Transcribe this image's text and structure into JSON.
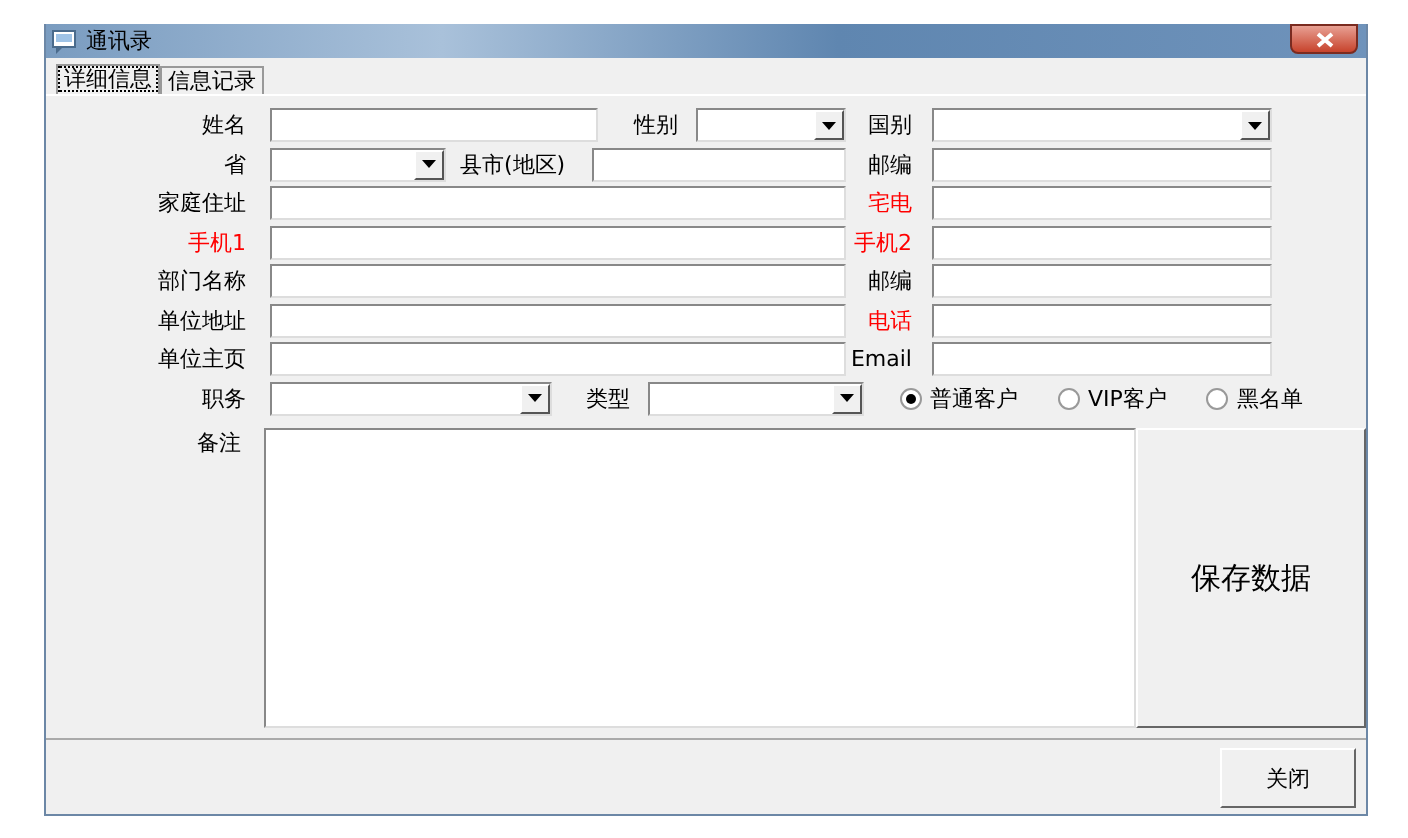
{
  "window": {
    "title": "通讯录"
  },
  "tabs": [
    {
      "label": "详细信息",
      "selected": true
    },
    {
      "label": "信息记录",
      "selected": false
    }
  ],
  "form_rows": [
    {
      "fields": [
        {
          "label": "姓名",
          "kind": "text",
          "color": "#000000"
        },
        {
          "label": "性别",
          "kind": "combo",
          "color": "#000000"
        },
        {
          "label": "国别",
          "kind": "combo",
          "color": "#000000"
        }
      ]
    },
    {
      "fields": [
        {
          "label": "省",
          "kind": "combo",
          "color": "#000000"
        },
        {
          "label": "县市(地区)",
          "kind": "text",
          "color": "#000000"
        },
        {
          "label": "邮编",
          "kind": "text",
          "color": "#000000"
        }
      ]
    },
    {
      "fields": [
        {
          "label": "家庭住址",
          "kind": "text",
          "color": "#000000"
        },
        {
          "label": "宅电",
          "kind": "text",
          "color": "#ff0000"
        }
      ]
    },
    {
      "fields": [
        {
          "label": "手机1",
          "kind": "text",
          "color": "#ff0000"
        },
        {
          "label": "手机2",
          "kind": "text",
          "color": "#ff0000"
        }
      ]
    },
    {
      "fields": [
        {
          "label": "部门名称",
          "kind": "text",
          "color": "#000000"
        },
        {
          "label": "邮编",
          "kind": "text",
          "color": "#000000"
        }
      ]
    },
    {
      "fields": [
        {
          "label": "单位地址",
          "kind": "text",
          "color": "#000000"
        },
        {
          "label": "电话",
          "kind": "text",
          "color": "#ff0000"
        }
      ]
    },
    {
      "fields": [
        {
          "label": "单位主页",
          "kind": "text",
          "color": "#000000"
        },
        {
          "label": "Email",
          "kind": "text",
          "color": "#000000"
        }
      ]
    },
    {
      "fields": [
        {
          "label": "职务",
          "kind": "combo",
          "color": "#000000"
        },
        {
          "label": "类型",
          "kind": "combo",
          "color": "#000000"
        }
      ]
    }
  ],
  "customer_type": [
    {
      "label": "普通客户",
      "selected": true
    },
    {
      "label": "VIP客户",
      "selected": false
    },
    {
      "label": "黑名单",
      "selected": false
    }
  ],
  "notes": {
    "label": "备注"
  },
  "save_button": "保存数据",
  "close_button": "关闭"
}
